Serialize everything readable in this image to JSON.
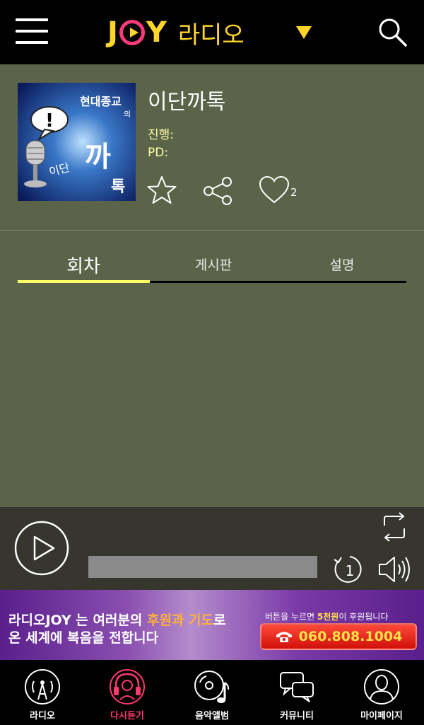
{
  "header": {
    "logo_letter_j": "J",
    "logo_letter_y": "Y",
    "logo_radio": "라디오"
  },
  "program": {
    "title": "이단까톡",
    "host_label": "진행:",
    "pd_label": "PD:",
    "like_count": "2",
    "cover": {
      "line1": "현대종교",
      "line2": "의",
      "line3": "이단",
      "line4": "까",
      "line5": "톡",
      "bubble": "!"
    }
  },
  "tabs": [
    {
      "label": "회차",
      "active": true
    },
    {
      "label": "게시판",
      "active": false
    },
    {
      "label": "설명",
      "active": false
    }
  ],
  "player": {
    "repeat_one_label": "1"
  },
  "banner": {
    "line1_a": "라디오JOY 는 여러분의 ",
    "line1_b": "후원과 기도",
    "line1_c": "로",
    "line2": "온 세계에 복음을 전합니다",
    "right_a": "버튼을 누르면 ",
    "right_b": "5천원",
    "right_c": "이 후원됩니다",
    "phone": "060.808.1004"
  },
  "bottom_nav": [
    {
      "label": "라디오",
      "icon": "radio-tower-icon",
      "active": false
    },
    {
      "label": "다시듣기",
      "icon": "headphones-icon",
      "active": true
    },
    {
      "label": "음악앨범",
      "icon": "music-disc-icon",
      "active": false
    },
    {
      "label": "커뮤니티",
      "icon": "chat-bubbles-icon",
      "active": false
    },
    {
      "label": "마이페이지",
      "icon": "user-icon",
      "active": false
    }
  ],
  "colors": {
    "accent_yellow": "#ffd52a",
    "logo_pink": "#ff3a7a",
    "panel_green": "#5b6449",
    "player_bg": "#36362e",
    "active_nav": "#ff3a6e",
    "tab_active_line": "#ffff66"
  }
}
